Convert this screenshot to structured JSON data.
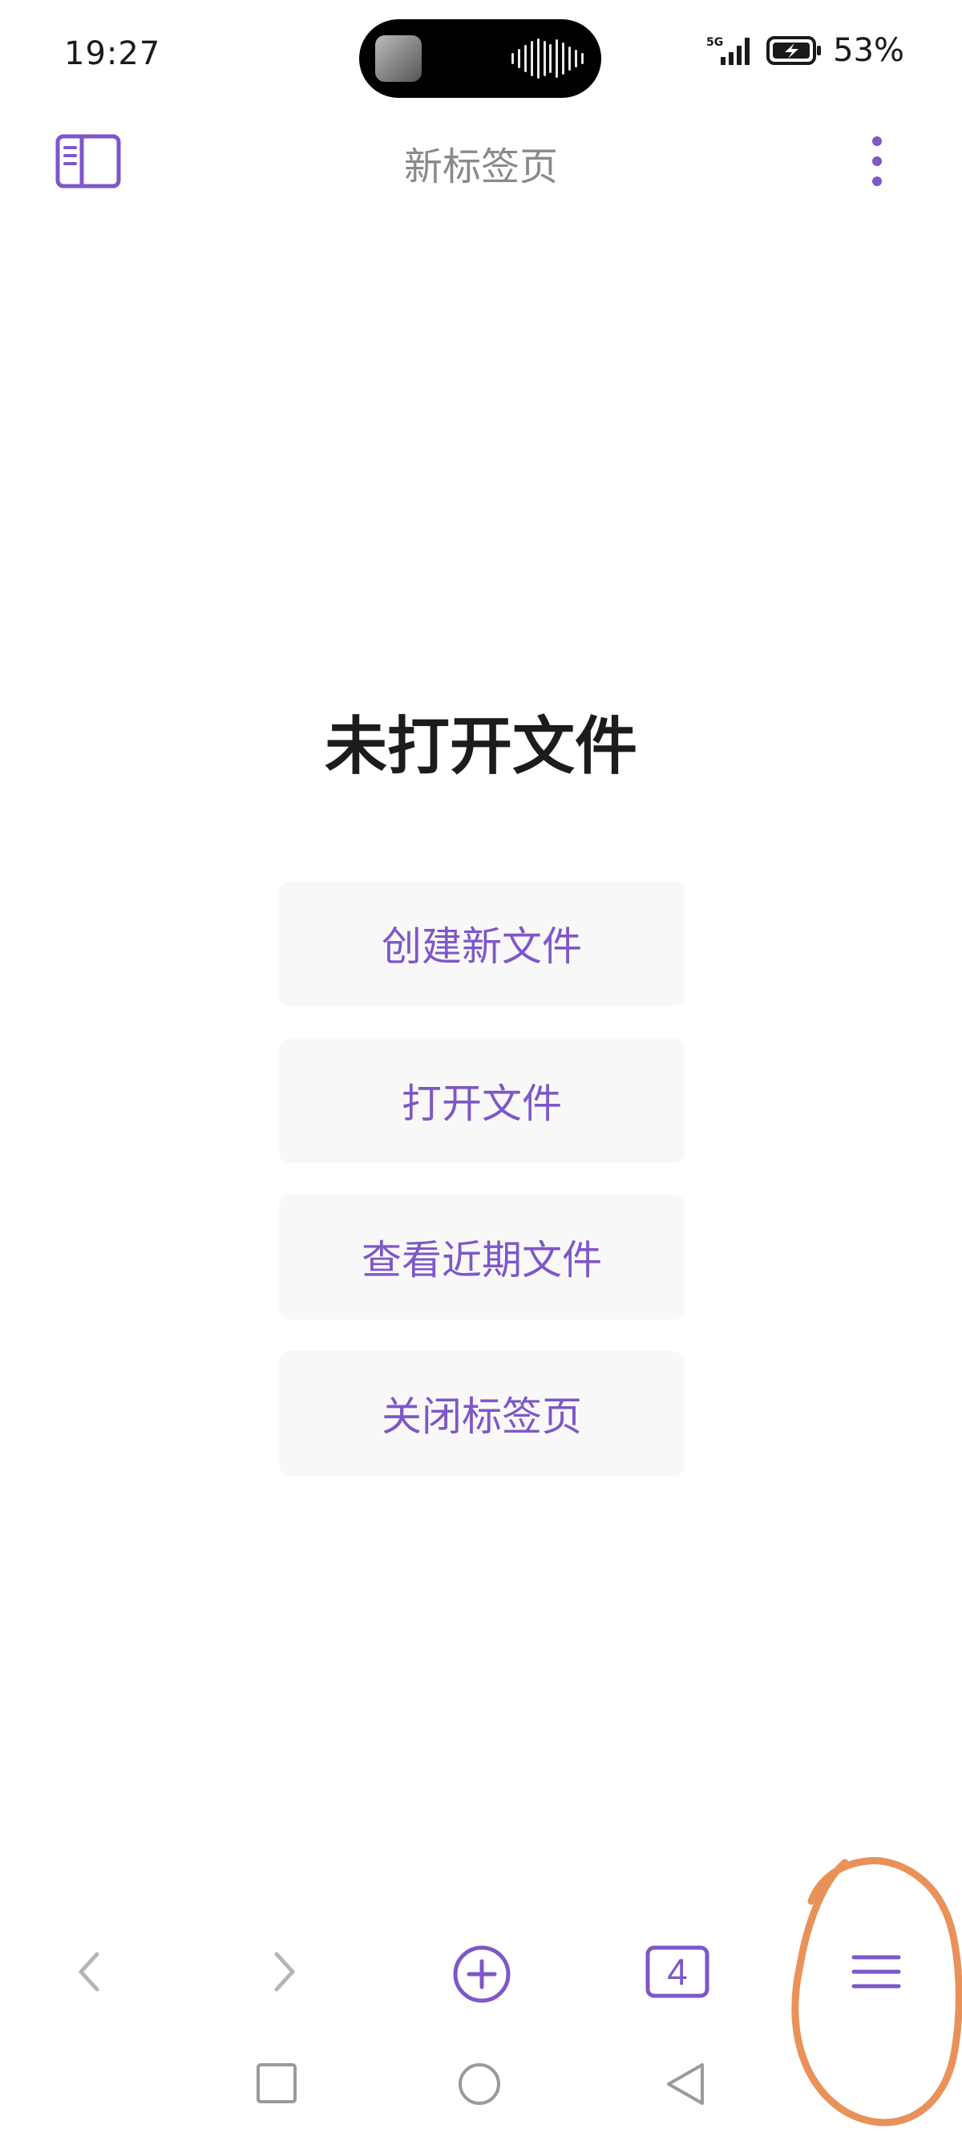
{
  "status_bar": {
    "time": "19:27",
    "network": "5G",
    "battery_percent": "53%"
  },
  "top_bar": {
    "title": "新标签页",
    "left_icon": "sidebar-icon",
    "right_icon": "more-vertical-icon"
  },
  "main": {
    "heading": "未打开文件",
    "actions": [
      {
        "label": "创建新文件"
      },
      {
        "label": "打开文件"
      },
      {
        "label": "查看近期文件"
      },
      {
        "label": "关闭标签页"
      }
    ]
  },
  "bottom_nav": {
    "back_icon": "chevron-left-icon",
    "forward_icon": "chevron-right-icon",
    "new_tab_icon": "plus-circle-icon",
    "tab_count": "4",
    "menu_icon": "menu-icon"
  },
  "system_nav": {
    "recents_icon": "square-icon",
    "home_icon": "circle-icon",
    "back_icon": "triangle-back-icon"
  },
  "colors": {
    "accent": "#7e57c8",
    "disabled": "#b5b5b5",
    "annotation": "#e8925a"
  }
}
